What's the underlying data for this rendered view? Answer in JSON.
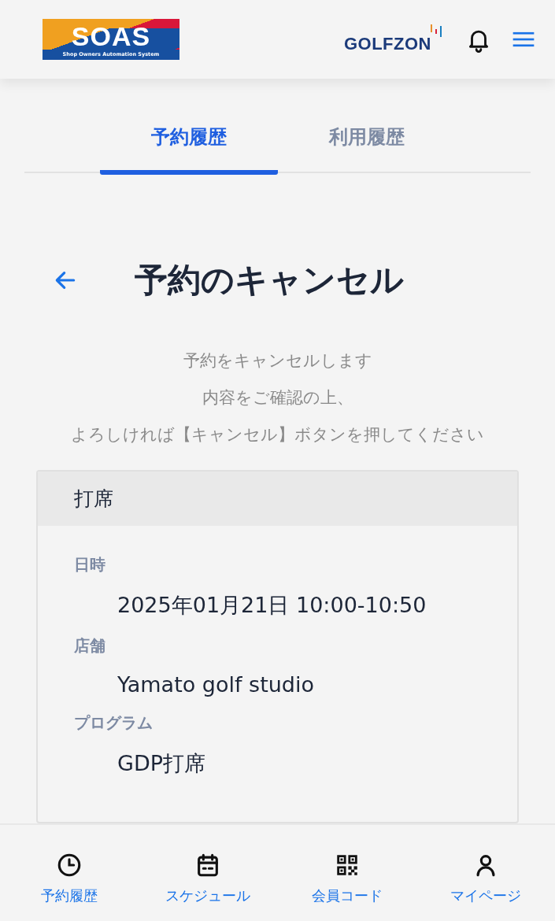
{
  "header": {
    "logo": {
      "title": "SOAS",
      "subtitle": "Shop Owners Automation System"
    },
    "brand": "GOLFZON"
  },
  "tabs": [
    {
      "label": "予約履歴",
      "selected": true
    },
    {
      "label": "利用履歴",
      "selected": false
    }
  ],
  "page_title": "予約のキャンセル",
  "message": [
    "予約をキャンセルします",
    "内容をご確認の上、",
    "よろしければ【キャンセル】ボタンを押してください"
  ],
  "card": {
    "title": "打席",
    "fields": [
      {
        "label": "日時",
        "value": "2025年01月21日 10:00-10:50"
      },
      {
        "label": "店舗",
        "value": "Yamato golf studio"
      },
      {
        "label": "プログラム",
        "value": "GDP打席"
      }
    ]
  },
  "bottom_nav": [
    {
      "kind": "clock",
      "label": "予約履歴"
    },
    {
      "kind": "calendar",
      "label": "スケジュール"
    },
    {
      "kind": "qr",
      "label": "会員コード"
    },
    {
      "kind": "person",
      "label": "マイページ"
    }
  ]
}
